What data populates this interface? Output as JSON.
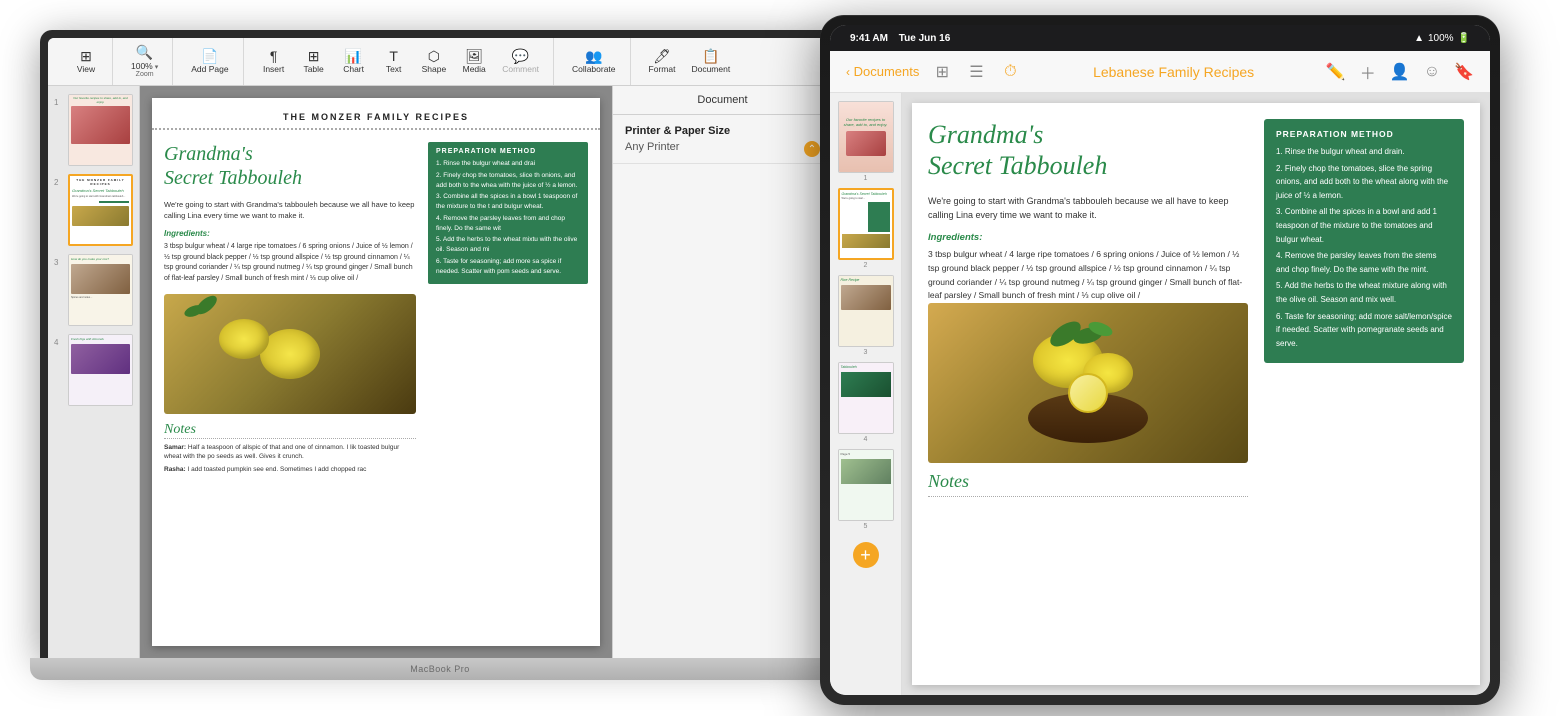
{
  "macbook": {
    "label": "MacBook Pro",
    "toolbar": {
      "view_label": "View",
      "zoom_label": "Zoom",
      "zoom_value": "100%",
      "add_page_label": "Add Page",
      "insert_label": "Insert",
      "table_label": "Table",
      "chart_label": "Chart",
      "text_label": "Text",
      "shape_label": "Shape",
      "media_label": "Media",
      "comment_label": "Comment",
      "collaborate_label": "Collaborate",
      "format_label": "Format",
      "document_label": "Document"
    },
    "document": {
      "title": "THE MONZER FAMILY RECIPES",
      "panel_header": "Document",
      "panel_printer_label": "Printer & Paper Size",
      "panel_printer_value": "Any Printer"
    },
    "recipe": {
      "title_line1": "Grandma's",
      "title_line2": "Secret Tabbouleh",
      "intro": "We're going to start with Grandma's tabbouleh because we all have to keep calling Lina every time we want to make it.",
      "ingredients_label": "Ingredients:",
      "ingredients_text": "3 tbsp bulgur wheat / 4 large ripe tomatoes / 6 spring onions / Juice of ½ lemon / ½ tsp ground black pepper / ½ tsp ground allspice / ½ tsp ground cinnamon / ¼ tsp ground coriander / ¼ tsp ground nutmeg / ¼ tsp ground ginger / Small bunch of flat-leaf parsley / Small bunch of fresh mint / ⅓ cup olive oil /",
      "prep_title": "PREPARATION METHOD",
      "prep_steps": [
        "Rinse the bulgur wheat and drai",
        "Finely chop the tomatoes, slice th onions, and add both to the whea with the juice of ½ a lemon.",
        "Combine all the spices in a bowl 1 teaspoon of the mixture to the t and bulgur wheat.",
        "Remove the parsley leaves from and chop finely. Do the same wit",
        "Add the herbs to the wheat mixtu with the olive oil. Season and mi",
        "Taste for seasoning; add more sa spice if needed. Scatter with pom seeds and serve."
      ],
      "notes_title": "Notes",
      "notes_samar": "Samar: Half a teaspoon of allspic of that and one of cinnamon. I lik toasted bulgur wheat with the po seeds as well. Gives it crunch.",
      "notes_rasha": "Rasha: I add toasted pumpkin see end. Sometimes I add chopped rac"
    },
    "thumbnails": [
      {
        "num": "1",
        "type": "cover"
      },
      {
        "num": "2",
        "type": "recipe-tabbouleh",
        "selected": true
      },
      {
        "num": "3",
        "type": "recipe-spices"
      },
      {
        "num": "4",
        "type": "recipe-figs"
      }
    ]
  },
  "ipad": {
    "status_bar": {
      "time": "9:41 AM",
      "date": "Tue Jun 16",
      "wifi": "WiFi",
      "battery": "100%"
    },
    "navbar": {
      "back_label": "Documents",
      "title": "Lebanese Family Recipes"
    },
    "recipe": {
      "title_line1": "Grandma's",
      "title_line2": "Secret Tabbouleh",
      "intro": "We're going to start with Grandma's tabbouleh because we all have to keep calling Lina every time we want to make it.",
      "ingredients_label": "Ingredients:",
      "ingredients_text": "3 tbsp bulgur wheat / 4 large ripe tomatoes / 6 spring onions / Juice of ½ lemon / ½ tsp ground black pepper / ½ tsp ground allspice / ½ tsp ground cinnamon / ¼ tsp ground coriander / ¼ tsp ground nutmeg / ¼ tsp ground ginger / Small bunch of flat-leaf parsley / Small bunch of fresh mint / ⅓ cup olive oil /",
      "prep_title": "PREPARATION METHOD",
      "prep_steps": [
        "Rinse the bulgur wheat and drain.",
        "Finely chop the tomatoes, slice the spring onions, and add both to the wheat along with the juice of ½ a lemon.",
        "Combine all the spices in a bowl and add 1 teaspoon of the mixture to the tomatoes and bulgur wheat.",
        "Remove the parsley leaves from the stems and chop finely. Do the same with the mint.",
        "Add the herbs to the wheat mixture along with the olive oil. Season and mix well.",
        "Taste for seasoning; add more salt/lemon/spice if needed. Scatter with pomegranate seeds and serve."
      ],
      "notes_title": "Notes"
    },
    "thumbnails": [
      {
        "num": "1",
        "type": "cover"
      },
      {
        "num": "2",
        "type": "recipe-tabbouleh",
        "selected": true
      },
      {
        "num": "3",
        "type": "recipe-spices"
      },
      {
        "num": "4",
        "type": "recipe-figs"
      },
      {
        "num": "5",
        "type": "recipe-extra"
      }
    ]
  }
}
